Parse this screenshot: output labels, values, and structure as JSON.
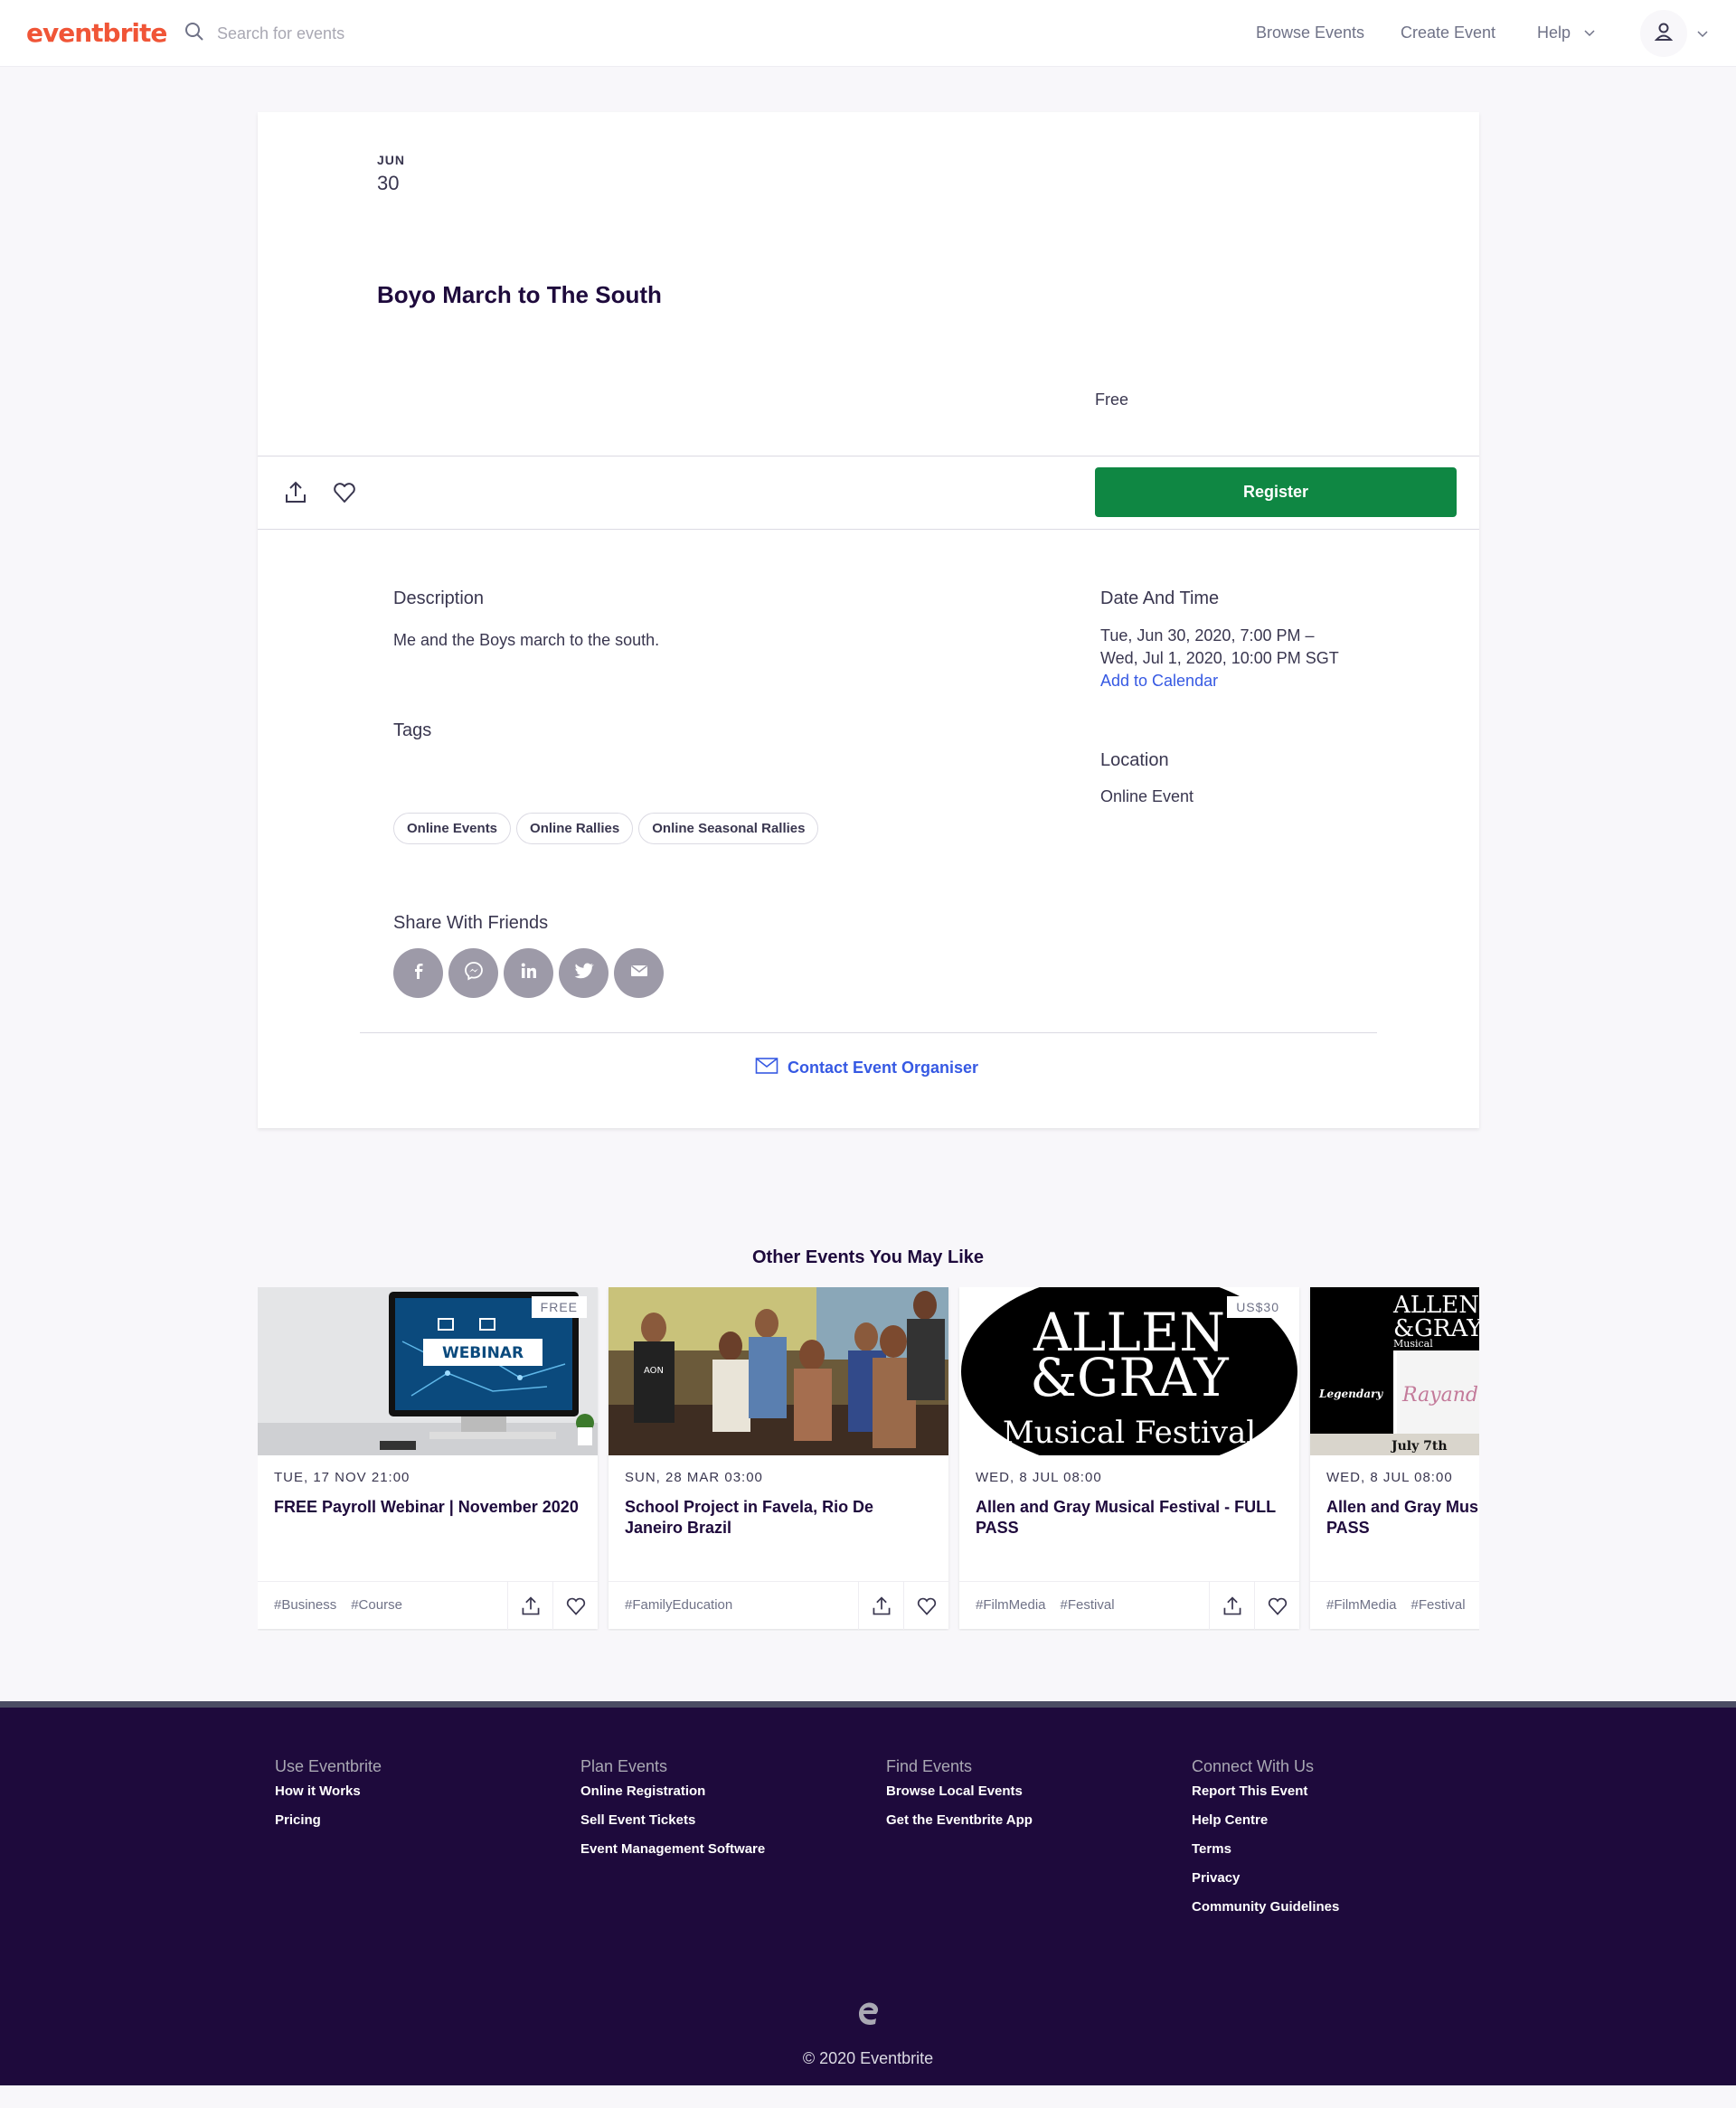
{
  "header": {
    "logo": "eventbrite",
    "search_placeholder": "Search for events",
    "nav_browse": "Browse Events",
    "nav_create": "Create Event",
    "nav_help": "Help"
  },
  "event": {
    "month": "JUN",
    "day": "30",
    "title": "Boyo March to The South",
    "price": "Free",
    "register_label": "Register",
    "description_heading": "Description",
    "description": "Me and the Boys march to the south.",
    "tags_heading": "Tags",
    "tags": [
      "Online Events",
      "Online Rallies",
      "Online Seasonal Rallies"
    ],
    "share_heading": "Share With Friends",
    "datetime_heading": "Date And Time",
    "datetime_line1": "Tue, Jun 30, 2020, 7:00 PM –",
    "datetime_line2": "Wed, Jul 1, 2020, 10:00 PM SGT",
    "add_calendar": "Add to Calendar",
    "location_heading": "Location",
    "location": "Online Event",
    "contact": "Contact Event Organiser"
  },
  "others": {
    "heading": "Other Events You May Like",
    "events": [
      {
        "badge": "FREE",
        "date": "TUE, 17 NOV 21:00",
        "name": "FREE Payroll Webinar | November 2020",
        "tags": [
          "#Business",
          "#Course"
        ],
        "image_text": "WEBINAR"
      },
      {
        "badge": "",
        "date": "SUN, 28 MAR 03:00",
        "name": "School Project in Favela, Rio De Janeiro Brazil",
        "tags": [
          "#FamilyEducation"
        ],
        "image_text": "AON"
      },
      {
        "badge": "US$30",
        "date": "WED, 8 JUL 08:00",
        "name": "Allen and Gray Musical Festival - FULL PASS",
        "tags": [
          "#FilmMedia",
          "#Festival"
        ],
        "image_line1": "ALLEN",
        "image_line2": "&GRAY",
        "image_line3": "Musical Festival"
      },
      {
        "badge": "",
        "date": "WED, 8 JUL 08:00",
        "name": "Allen and Gray Musical Festival - FULL PASS",
        "tags": [
          "#FilmMedia",
          "#Festival"
        ],
        "image_line1": "ALLEN",
        "image_line2": "&GRAY",
        "image_line3": "Musical",
        "image_legendary": "Legendary",
        "image_sig": "Rayand",
        "image_date": "July 7th"
      }
    ]
  },
  "footer": {
    "col1_head": "Use Eventbrite",
    "col1_links": [
      "How it Works",
      "Pricing"
    ],
    "col2_head": "Plan Events",
    "col2_links": [
      "Online Registration",
      "Sell Event Tickets",
      "Event Management Software"
    ],
    "col3_head": "Find Events",
    "col3_links": [
      "Browse Local Events",
      "Get the Eventbrite App"
    ],
    "col4_head": "Connect With Us",
    "col4_links": [
      "Report This Event",
      "Help Centre",
      "Terms",
      "Privacy",
      "Community Guidelines"
    ],
    "copyright": "© 2020 Eventbrite"
  },
  "colors": {
    "brand": "#f05537",
    "register": "#0f8743",
    "link": "#3659e3",
    "footer_bg": "#1e0a3c"
  },
  "icons": [
    "search-icon",
    "chevron-down-icon",
    "user-icon",
    "share-icon",
    "heart-icon",
    "facebook-icon",
    "messenger-icon",
    "linkedin-icon",
    "twitter-icon",
    "email-icon",
    "envelope-icon",
    "eventbrite-e-icon"
  ]
}
